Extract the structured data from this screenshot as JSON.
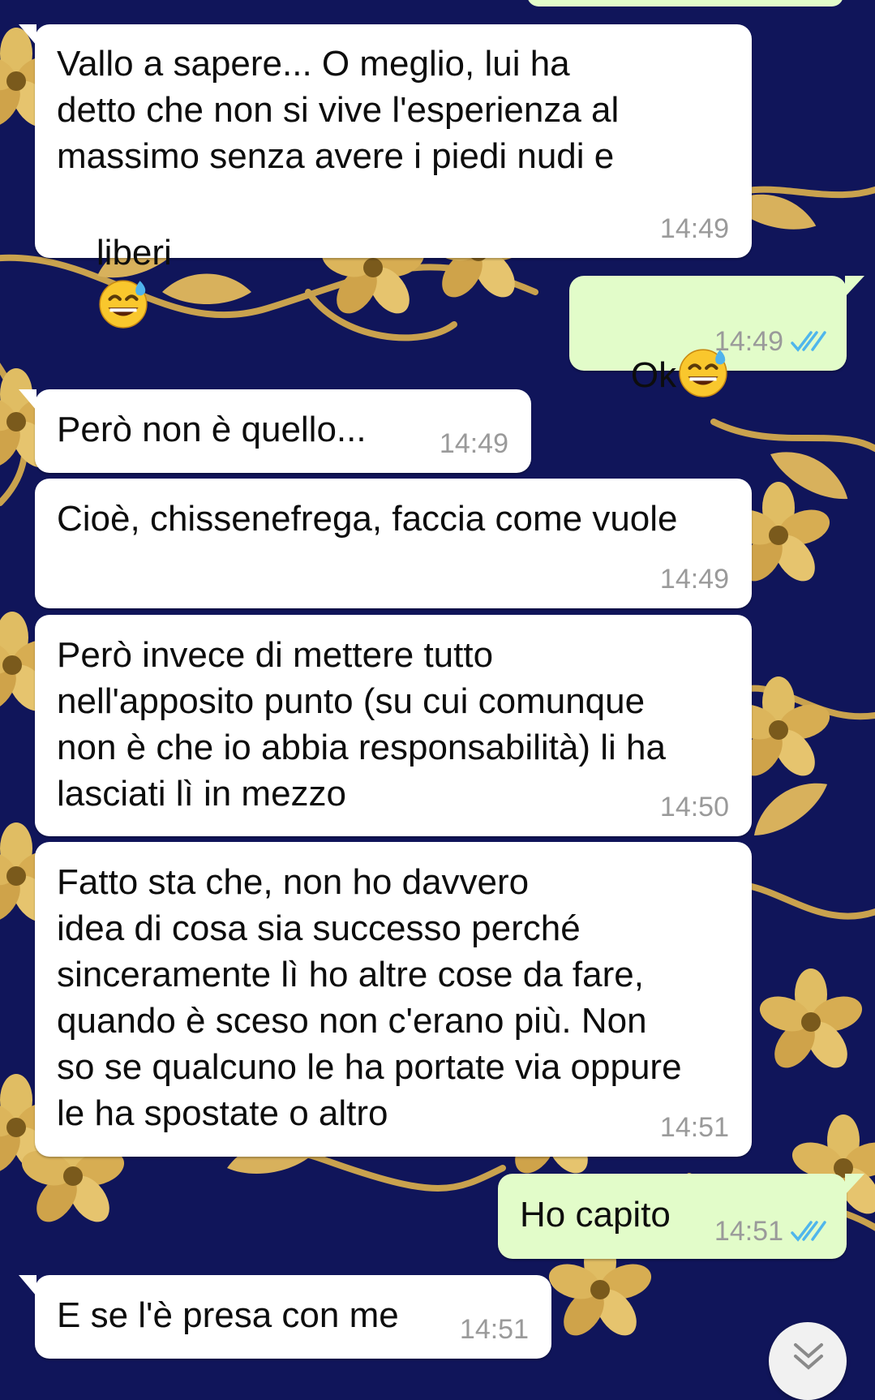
{
  "messages": [
    {
      "direction": "in",
      "lines": [
        "Vallo a sapere... O meglio, lui ha",
        "detto che non si vive l'esperienza al",
        "massimo senza avere i piedi nudi e",
        "liberi"
      ],
      "emoji": "grinning-sweat-emoji",
      "time": "14:49"
    },
    {
      "direction": "out",
      "text": "Ok",
      "emoji": "grinning-sweat-emoji",
      "time": "14:49",
      "status": "read-double-check"
    },
    {
      "direction": "in",
      "lines": [
        "Però non è quello..."
      ],
      "time": "14:49"
    },
    {
      "direction": "in",
      "lines": [
        "Cioè, chissenefrega, faccia come vuole"
      ],
      "time": "14:49"
    },
    {
      "direction": "in",
      "lines": [
        "Però invece di mettere tutto",
        "nell'apposito punto (su cui comunque",
        "non è che io abbia responsabilità) li ha",
        "lasciati lì in mezzo"
      ],
      "time": "14:50"
    },
    {
      "direction": "in",
      "lines": [
        "Fatto sta che, non ho davvero",
        "idea di cosa sia successo perché",
        "sinceramente lì ho altre cose da fare,",
        "quando è sceso non c'erano più. Non",
        "so se qualcuno le ha portate via oppure",
        "le ha spostate o altro"
      ],
      "time": "14:51"
    },
    {
      "direction": "out",
      "text": "Ho capito",
      "time": "14:51",
      "status": "read-double-check"
    },
    {
      "direction": "in",
      "lines": [
        "E se l'è presa con me"
      ],
      "time": "14:51"
    }
  ],
  "colors": {
    "wallpaper_bg": "#10155a",
    "wallpaper_flowers": "#d9b25a",
    "incoming_bubble": "#ffffff",
    "outgoing_bubble": "#e2fcc9",
    "timestamp": "#9a9a9a",
    "read_ticks": "#4fb6ec"
  },
  "icons": [
    "grinning-sweat-emoji",
    "double-check-icon",
    "chevron-down-icon"
  ]
}
